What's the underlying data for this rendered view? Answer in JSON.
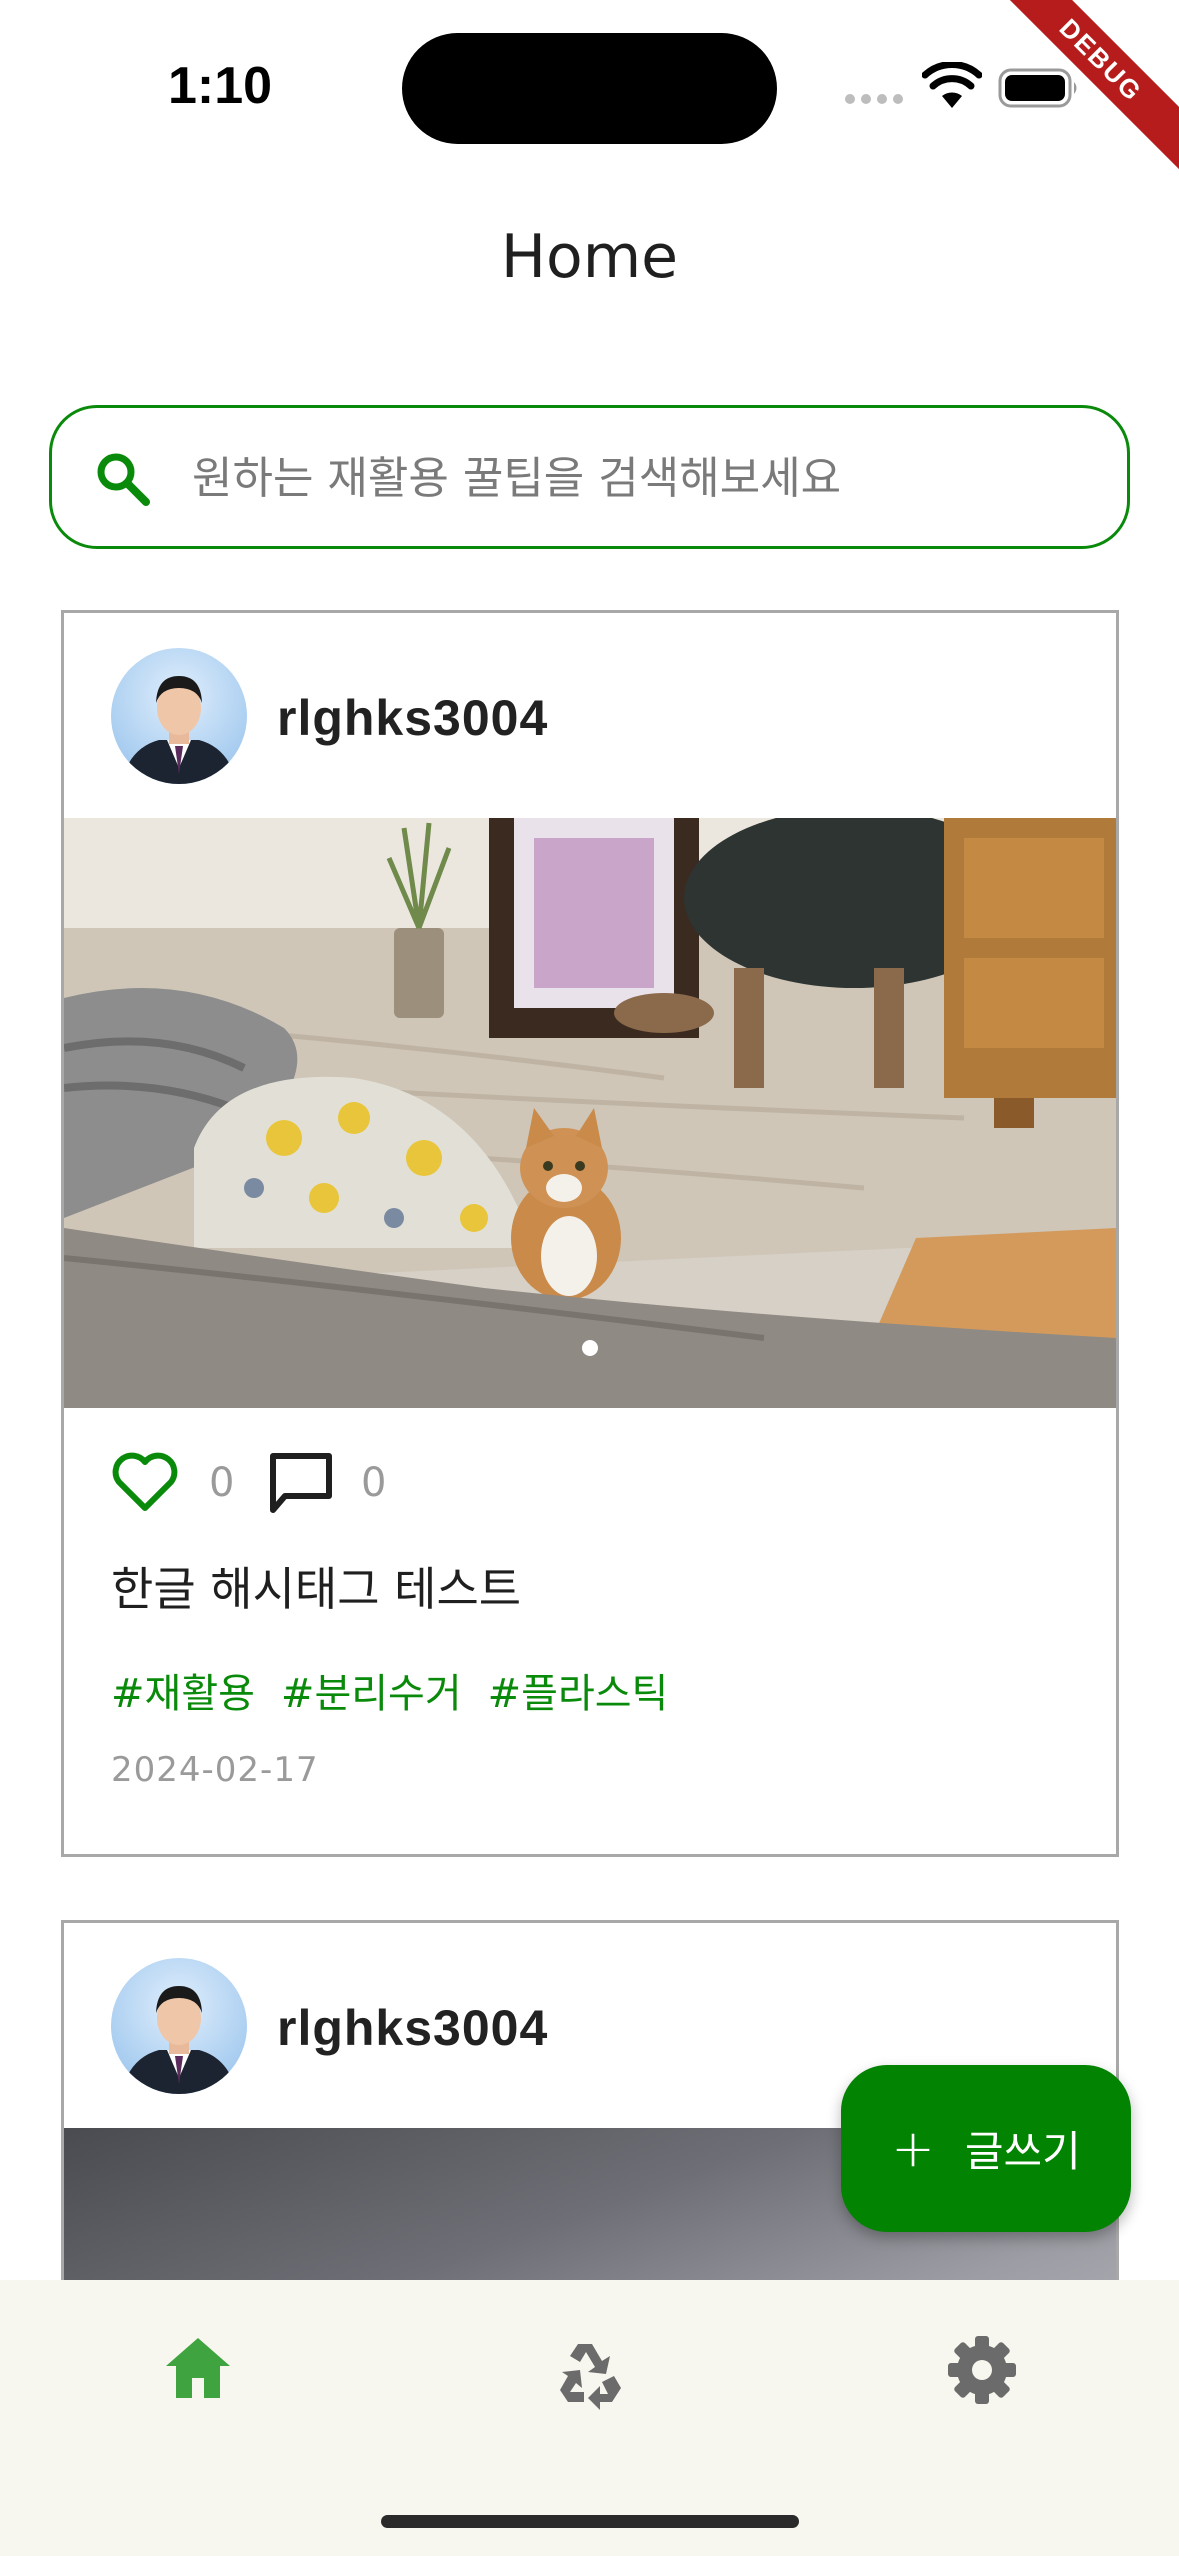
{
  "status_bar": {
    "time": "1:10",
    "debug_label": "DEBUG"
  },
  "app_bar": {
    "title": "Home"
  },
  "search": {
    "placeholder": "원하는 재활용 꿀팁을 검색해보세요",
    "value": ""
  },
  "posts": [
    {
      "username": "rlghks3004",
      "likes": "0",
      "comments": "0",
      "text": "한글 해시태그 테스트",
      "tags": [
        "#재활용",
        "#분리수거",
        "#플라스틱"
      ],
      "date": "2024-02-17",
      "image_count": 1,
      "active_image_index": 0
    },
    {
      "username": "rlghks3004"
    }
  ],
  "fab": {
    "icon": "plus-icon",
    "label": "글쓰기"
  },
  "bottom_nav": {
    "items": [
      {
        "icon": "home-icon",
        "active": true
      },
      {
        "icon": "recycle-icon",
        "active": false
      },
      {
        "icon": "gear-icon",
        "active": false
      }
    ]
  },
  "colors": {
    "accent": "#0a8a0a",
    "fab": "#028302",
    "nav_active": "#3fa33f",
    "nav_inactive": "#6b6b6b",
    "nav_background": "#f7f7ef"
  }
}
